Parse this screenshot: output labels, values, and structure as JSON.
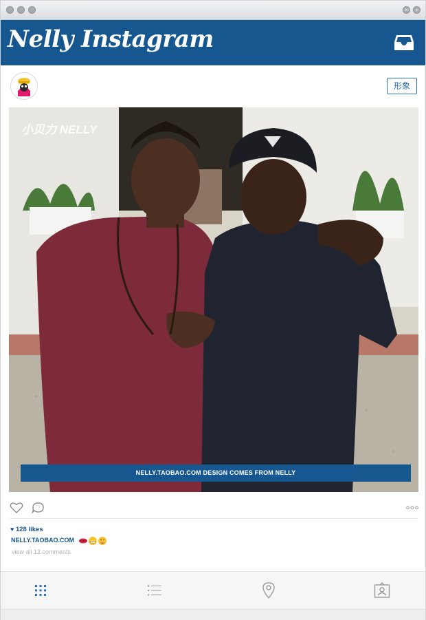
{
  "app": {
    "brand_title": "Nelly Instagram"
  },
  "profile": {
    "follow_label": "形象"
  },
  "photo": {
    "overlay_brand": "小贝力 NELLY",
    "caption_banner": "NELLY.TAOBAO.COM DESIGN COMES FROM NELLY"
  },
  "post": {
    "likes": "128 likes",
    "username": "NELLY.TAOBAO.COM",
    "view_comments": "view all 12 comments"
  },
  "colors": {
    "brand_blue": "#16578f",
    "accent_blue": "#2e74b5"
  },
  "icons": {
    "inbox": "inbox-icon",
    "heart": "heart-icon",
    "comment": "comment-icon",
    "more": "more-icon",
    "grid": "grid-icon",
    "list": "list-icon",
    "location": "location-pin-icon",
    "tagged": "tagged-user-icon"
  }
}
